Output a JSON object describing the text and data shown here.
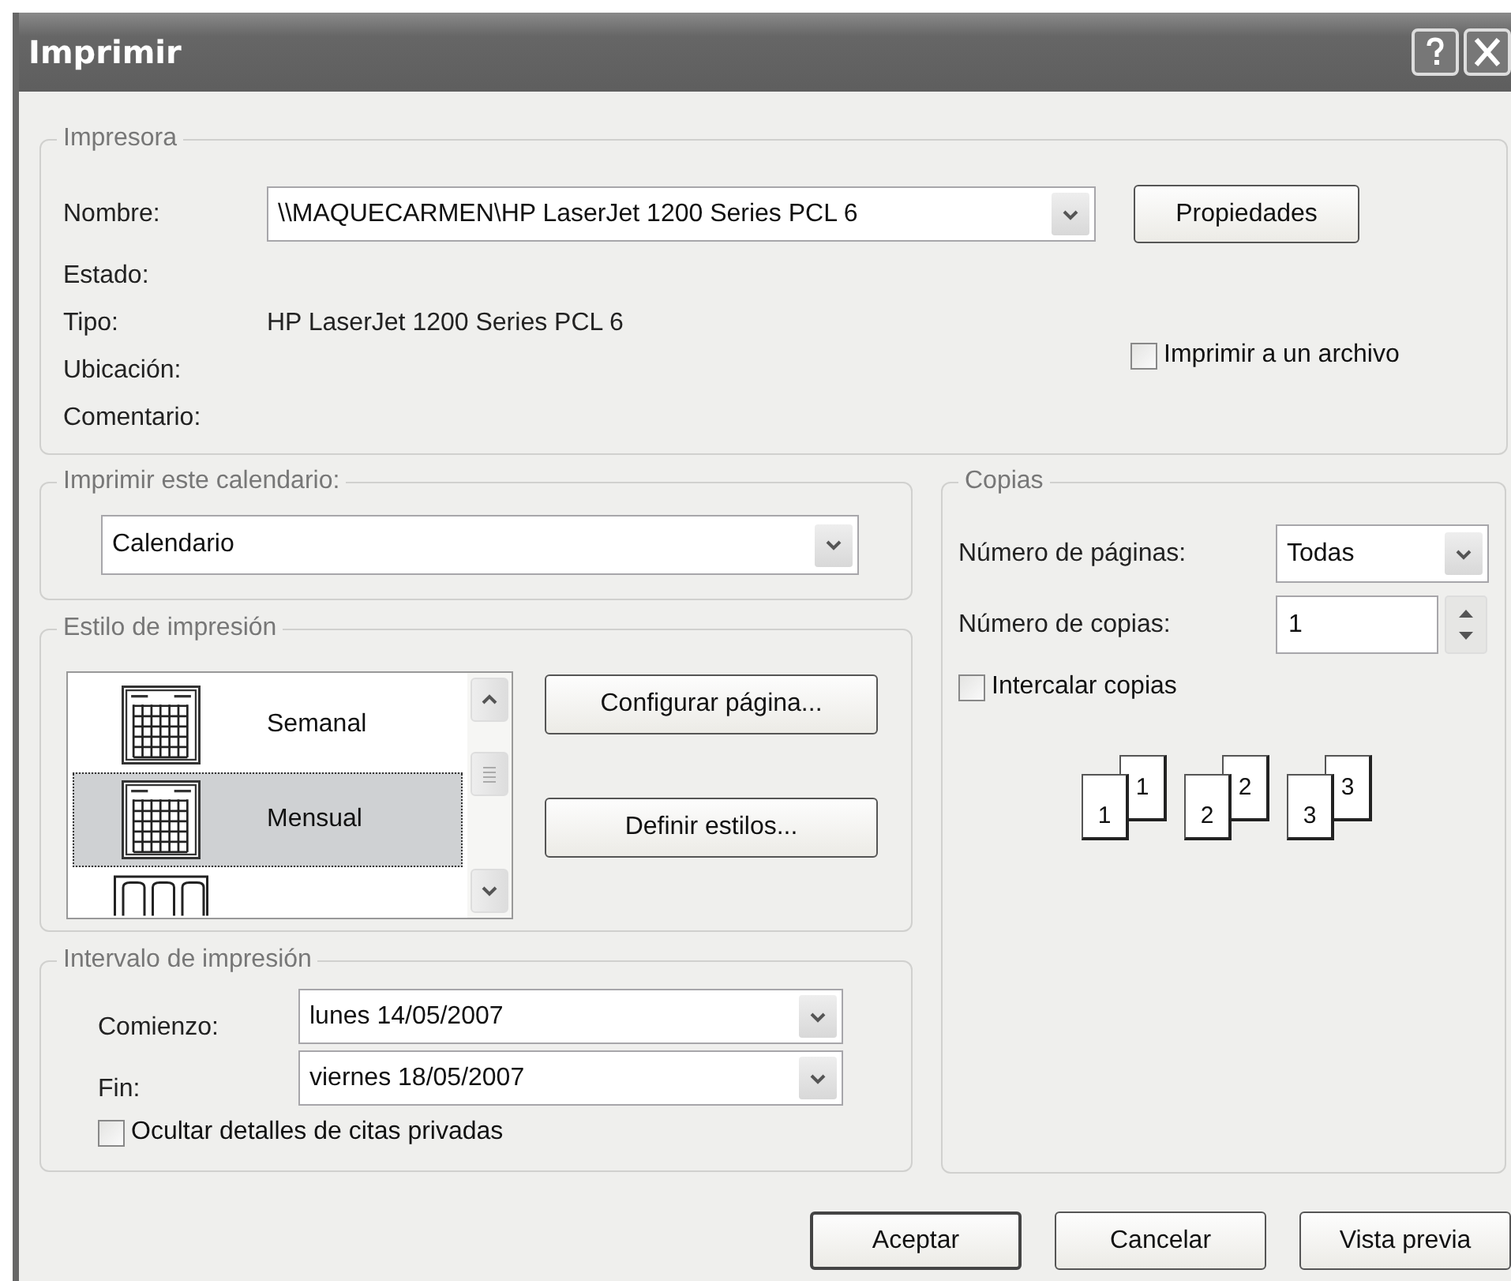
{
  "window": {
    "title": "Imprimir"
  },
  "printer": {
    "group": "Impresora",
    "name_label": "Nombre:",
    "name_value": "\\\\MAQUECARMEN\\HP LaserJet 1200 Series PCL 6",
    "properties_button": "Propiedades",
    "fields": [
      {
        "label": "Estado:"
      },
      {
        "label": "Tipo:",
        "value": "HP LaserJet 1200 Series PCL 6"
      },
      {
        "label": "Ubicación:"
      },
      {
        "label": "Comentario:"
      }
    ],
    "print_to_file": {
      "label": "Imprimir a un archivo",
      "checked": false
    }
  },
  "calendar": {
    "group": "Imprimir este calendario:",
    "value": "Calendario"
  },
  "style": {
    "group": "Estilo de impresión",
    "items": [
      {
        "label": "Semanal",
        "kind": "grid",
        "selected": false
      },
      {
        "label": "Mensual",
        "kind": "grid",
        "selected": true
      },
      {
        "kind": "columns",
        "selected": false
      }
    ],
    "buttons": [
      "Configurar página...",
      "Definir estilos..."
    ]
  },
  "range": {
    "group": "Intervalo de impresión",
    "start_label": "Comienzo:",
    "start_value": "lunes 14/05/2007",
    "end_label": "Fin:",
    "end_value": "viernes 18/05/2007",
    "hide_private": {
      "label": "Ocultar detalles de citas privadas",
      "checked": false
    }
  },
  "copies": {
    "group": "Copias",
    "pages_label": "Número de páginas:",
    "pages_value": "Todas",
    "copies_label": "Número de copias:",
    "copies_value": "1",
    "collate": {
      "label": "Intercalar copias",
      "checked": false
    },
    "sets": [
      {
        "front": "1",
        "back": "1"
      },
      {
        "front": "2",
        "back": "2"
      },
      {
        "front": "3",
        "back": "3"
      }
    ]
  },
  "buttons": [
    "Aceptar",
    "Cancelar",
    "Vista previa"
  ]
}
